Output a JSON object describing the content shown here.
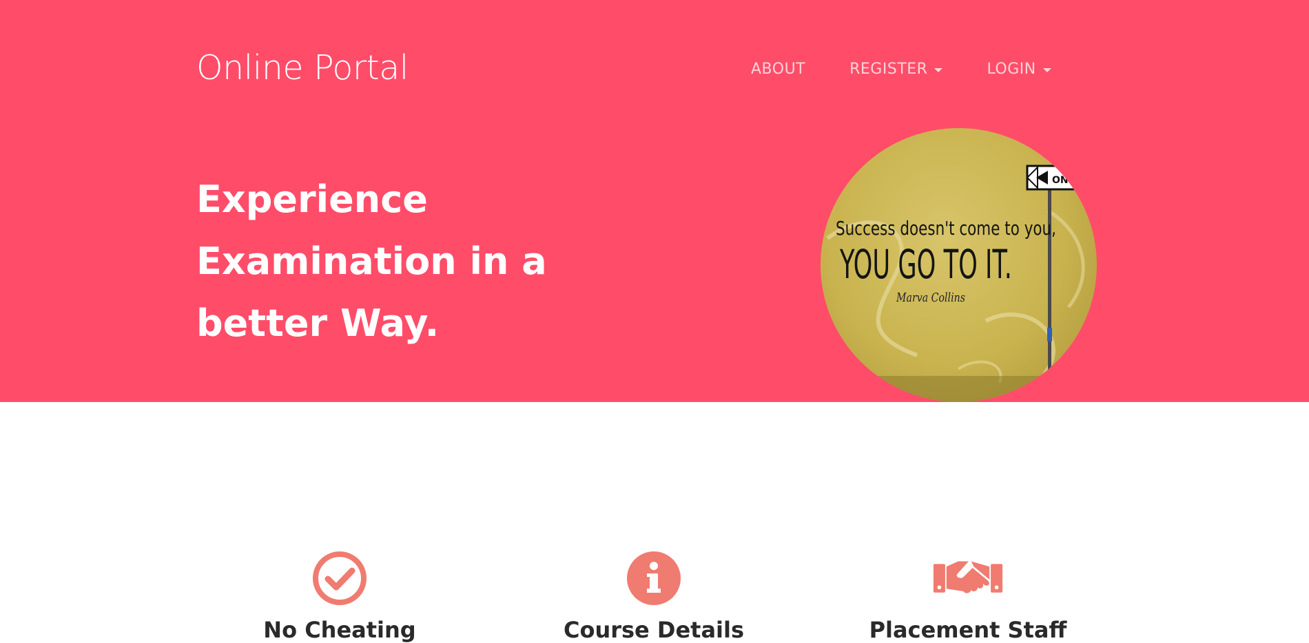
{
  "brand": {
    "title": "Online Portal"
  },
  "nav": {
    "about": "ABOUT",
    "register": "REGISTER",
    "login": "LOGIN"
  },
  "hero": {
    "headline_line1": "Experience",
    "headline_line2": "Examination in a",
    "headline_line3": "better Way.",
    "image": {
      "text_line1": "Success doesn't come to you,",
      "text_line2": "YOU GO TO IT.",
      "author": "Marva Collins",
      "sign_text": "ONE W"
    }
  },
  "features": [
    {
      "title": "No Cheating",
      "icon": "check-circle-icon"
    },
    {
      "title": "Course Details",
      "icon": "info-circle-icon"
    },
    {
      "title": "Placement Staff",
      "icon": "handshake-icon"
    }
  ],
  "colors": {
    "hero_background": "#ff4d69",
    "icon_accent": "#f07b70",
    "nav_text": "#ffd3da",
    "heading_text": "#2a2a2a"
  }
}
